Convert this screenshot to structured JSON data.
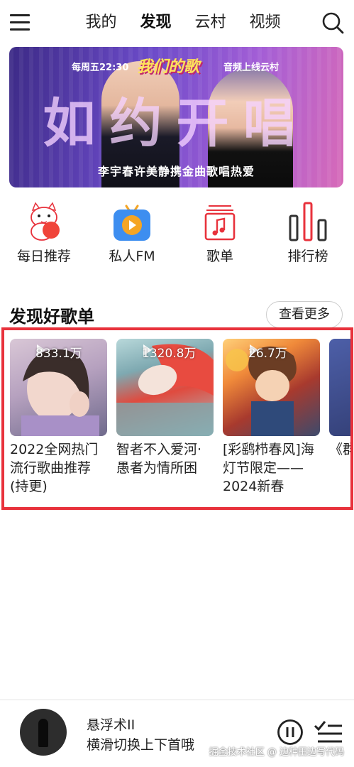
{
  "nav": {
    "tabs": [
      {
        "label": "我的",
        "active": false
      },
      {
        "label": "发现",
        "active": true
      },
      {
        "label": "云村",
        "active": false
      },
      {
        "label": "视频",
        "active": false
      }
    ],
    "icons": {
      "menu": "hamburger-menu-icon",
      "search": "search-icon"
    }
  },
  "banner": {
    "schedule": "每周五22:30",
    "logo": "我们的歌",
    "online": "音频上线云村",
    "headline": "如约开唱",
    "subtitle": "李宇春许美静携金曲歌唱热爱"
  },
  "entries": [
    {
      "label": "每日推荐",
      "icon": "lucky-cat-icon"
    },
    {
      "label": "私人FM",
      "icon": "tv-play-icon"
    },
    {
      "label": "歌单",
      "icon": "music-note-icon"
    },
    {
      "label": "排行榜",
      "icon": "bar-chart-icon"
    }
  ],
  "section": {
    "title": "发现好歌单",
    "more": "查看更多"
  },
  "playlists": [
    {
      "count": "833.1万",
      "name": "2022全网热门流行歌曲推荐(持更)"
    },
    {
      "count": "1320.8万",
      "name": "智者不入爱河·愚者为情所困"
    },
    {
      "count": "26.7万",
      "name": "[彩鹞栉春风]海灯节限定——2024新春"
    },
    {
      "count": "",
      "name": "《群录"
    }
  ],
  "player": {
    "song": "悬浮术II",
    "hint": "横滑切换上下首哦",
    "watermark": "掘金技术社区 @ 边种田边写代码"
  },
  "colors": {
    "accent": "#e8323c",
    "fm_blue": "#3d8ef0",
    "fm_orange": "#f5a524",
    "chart_red": "#e8323c",
    "chart_dark": "#333333"
  }
}
